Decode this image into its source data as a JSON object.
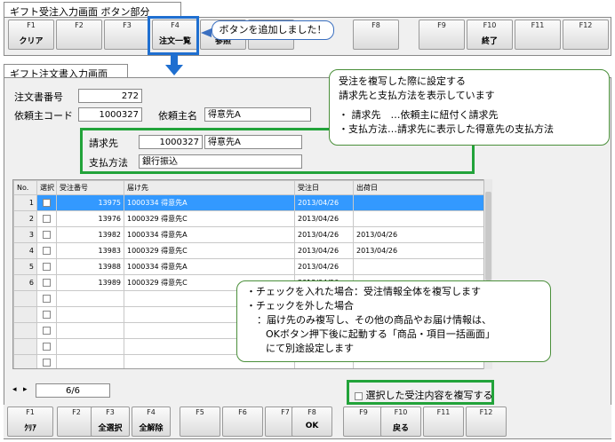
{
  "top_tab": "ギフト受注入力画面 ボタン部分",
  "top_keys": [
    {
      "key": "F1",
      "label": "クリア"
    },
    {
      "key": "F2",
      "label": ""
    },
    {
      "key": "F3",
      "label": ""
    },
    {
      "key": "F4",
      "label": "注文一覧"
    },
    {
      "key": "",
      "label": "参照"
    },
    {
      "key": "",
      "label": ""
    },
    {
      "key": "F8",
      "label": ""
    },
    {
      "key": "F9",
      "label": ""
    },
    {
      "key": "F10",
      "label": "終了"
    },
    {
      "key": "F11",
      "label": ""
    },
    {
      "key": "F12",
      "label": ""
    }
  ],
  "callout_top": "ボタンを追加しました！",
  "window_tab": "ギフト注文書入力画面",
  "order_no_label": "注文書番号",
  "order_no": "272",
  "requester_code_label": "依頼主コード",
  "requester_code": "1000327",
  "requester_name_label": "依頼主名",
  "requester_name": "得意先A",
  "billing_label": "請求先",
  "billing_code": "1000327",
  "billing_name": "得意先A",
  "payment_label": "支払方法",
  "payment_value": "銀行振込",
  "callout_billing": {
    "line1": "受注を複写した際に設定する",
    "line2": "請求先と支払方法を表示しています",
    "line3": "・ 請求先　…依頼主に紐付く請求先",
    "line4": "・支払方法…請求先に表示した得意先の支払方法"
  },
  "grid": {
    "headers": [
      "No.",
      "選択",
      "受注番号",
      "届け先",
      "受注日",
      "出荷日"
    ],
    "rows": [
      {
        "no": "1",
        "order": "13975",
        "dest": "1000334 得意先A",
        "date": "2013/04/26",
        "ship": ""
      },
      {
        "no": "2",
        "order": "13976",
        "dest": "1000329 得意先C",
        "date": "2013/04/26",
        "ship": ""
      },
      {
        "no": "3",
        "order": "13982",
        "dest": "1000334 得意先A",
        "date": "2013/04/26",
        "ship": "2013/04/26"
      },
      {
        "no": "4",
        "order": "13983",
        "dest": "1000329 得意先C",
        "date": "2013/04/26",
        "ship": "2013/04/26"
      },
      {
        "no": "5",
        "order": "13988",
        "dest": "1000334 得意先A",
        "date": "2013/04/26",
        "ship": ""
      },
      {
        "no": "6",
        "order": "13989",
        "dest": "1000329 得意先C",
        "date": "2013/04/26",
        "ship": ""
      }
    ]
  },
  "callout_check": {
    "line1": "・チェックを入れた場合：受注情報全体を複写します",
    "line2": "・チェックを外した場合",
    "line3": "：届け先のみ複写し、その他の商品やお届け情報は、",
    "line4": "OKボタン押下後に起動する「商品・項目一括画面」",
    "line5": "にて別途設定します"
  },
  "pager": "6/6",
  "copy_checkbox_label": "選択した受注内容を複写する",
  "bottom_keys": [
    {
      "key": "F1",
      "label": "ｸﾘｱ"
    },
    {
      "key": "F2",
      "label": ""
    },
    {
      "key": "F3",
      "label": "全選択"
    },
    {
      "key": "F4",
      "label": "全解除"
    },
    {
      "key": "F5",
      "label": ""
    },
    {
      "key": "F6",
      "label": ""
    },
    {
      "key": "F7",
      "label": ""
    },
    {
      "key": "F8",
      "label": "OK"
    },
    {
      "key": "F9",
      "label": ""
    },
    {
      "key": "F10",
      "label": "戻る"
    },
    {
      "key": "F11",
      "label": ""
    },
    {
      "key": "F12",
      "label": ""
    }
  ],
  "colors": {
    "accent_blue": "#1f6fd0",
    "highlight_green": "#22a33a",
    "selection": "#3399ff"
  }
}
